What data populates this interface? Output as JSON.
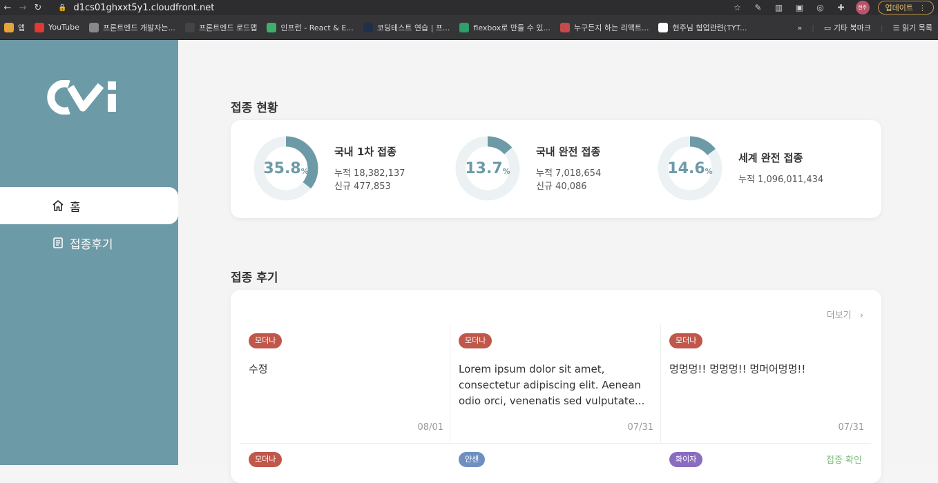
{
  "browser": {
    "url": "d1cs01ghxxt5y1.cloudfront.net",
    "profile_label": "현주",
    "update_label": "업데이트",
    "bookmarks": [
      {
        "label": "앱",
        "icon": "apps-grid-icon",
        "color": "#e8a33a"
      },
      {
        "label": "YouTube",
        "icon": "youtube-icon",
        "color": "#e03a32"
      },
      {
        "label": "프론트엔드 개발자는...",
        "icon": "globe-icon",
        "color": "#888888"
      },
      {
        "label": "프론트엔드 로드맵",
        "icon": "github-icon",
        "color": "#444444"
      },
      {
        "label": "인프런 - React & E...",
        "icon": "inflearn-icon",
        "color": "#3fb06a"
      },
      {
        "label": "코딩테스트 연습 | 프...",
        "icon": "programmers-icon",
        "color": "#20304a"
      },
      {
        "label": "flexbox로 만들 수 있...",
        "icon": "d2-icon",
        "color": "#2f9f6b"
      },
      {
        "label": "누구든지 하는 리액트...",
        "icon": "velog-icon",
        "color": "#c64a4a"
      },
      {
        "label": "현주님 협업관련(TYT...",
        "icon": "notion-icon",
        "color": "#ffffff"
      }
    ],
    "bookmark_more": "»",
    "other_bookmarks": "기타 북마크",
    "reading_list": "읽기 목록"
  },
  "sidebar": {
    "logo": "CVI",
    "items": [
      {
        "label": "홈",
        "icon": "home-icon"
      },
      {
        "label": "접종후기",
        "icon": "document-icon"
      }
    ]
  },
  "status": {
    "title": "접종 현황",
    "items": [
      {
        "percent": 35.8,
        "value": "35.8",
        "unit": "%",
        "title": "국내 1차 접종",
        "cumulative": "누적 18,382,137",
        "new": "신규 477,853"
      },
      {
        "percent": 13.7,
        "value": "13.7",
        "unit": "%",
        "title": "국내 완전 접종",
        "cumulative": "누적 7,018,654",
        "new": "신규 40,086"
      },
      {
        "percent": 14.6,
        "value": "14.6",
        "unit": "%",
        "title": "세계 완전 접종",
        "cumulative": "누적 1,096,011,434",
        "new": ""
      }
    ]
  },
  "reviews": {
    "title": "접종 후기",
    "more_label": "더보기",
    "items": [
      {
        "tag": "모더나",
        "tag_color": "#c0574b",
        "text": "수정",
        "date": "08/01"
      },
      {
        "tag": "모더나",
        "tag_color": "#c0574b",
        "text": "Lorem ipsum dolor sit amet, consectetur adipiscing elit. Aenean odio orci, venenatis sed vulputate...",
        "date": "07/31"
      },
      {
        "tag": "모더나",
        "tag_color": "#c0574b",
        "text": "멍멍멍!! 멍멍멍!! 멍머어멍멍!!",
        "date": "07/31"
      }
    ],
    "second_row": [
      {
        "tag": "모더나",
        "tag_color": "#c0574b"
      },
      {
        "tag": "얀센",
        "tag_color": "#6f8fc0"
      },
      {
        "tag": "화이자",
        "tag_color": "#8a6cc0"
      }
    ],
    "confirm_label": "접종 확인"
  },
  "colors": {
    "sidebar": "#6d9aa7",
    "accent": "#6d9aa7",
    "donut_track": "#ecf2f4"
  }
}
